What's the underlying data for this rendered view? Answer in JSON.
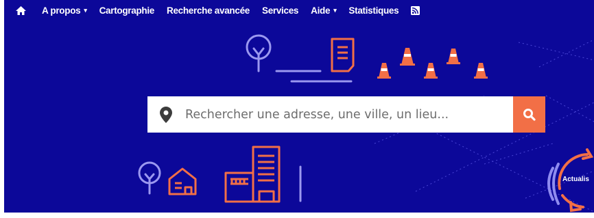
{
  "nav": {
    "items": [
      {
        "label": "A propos",
        "has_caret": true
      },
      {
        "label": "Cartographie",
        "has_caret": false
      },
      {
        "label": "Recherche avancée",
        "has_caret": false
      },
      {
        "label": "Services",
        "has_caret": false
      },
      {
        "label": "Aide",
        "has_caret": true
      },
      {
        "label": "Statistiques",
        "has_caret": false
      }
    ],
    "caret": "▾",
    "icons": [
      "home-icon",
      "rss-icon"
    ]
  },
  "search": {
    "placeholder": "Rechercher une adresse, une ville, un lieu...",
    "icons": [
      "map-pin-icon",
      "search-icon"
    ]
  },
  "badge": {
    "text": "Actualis"
  },
  "colors": {
    "background": "#0c0899",
    "accent": "#f26f46",
    "line": "#8f8cf0"
  }
}
